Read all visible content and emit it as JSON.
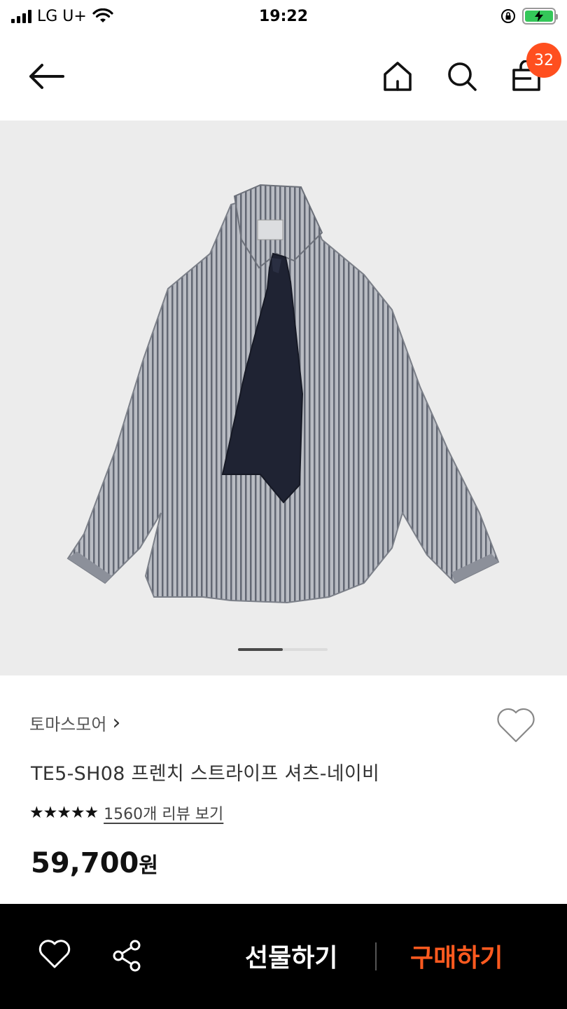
{
  "status_bar": {
    "carrier": "LG U+",
    "time": "19:22"
  },
  "nav": {
    "cart_count": "32",
    "icons": [
      "back-arrow-icon",
      "home-icon",
      "search-icon",
      "shopping-bag-icon"
    ]
  },
  "gallery": {
    "current_image": 1,
    "total_images": 2
  },
  "product": {
    "brand": "토마스모어",
    "brand_chevron": "›",
    "title": "TE5-SH08 프렌치 스트라이프 셔츠-네이비",
    "stars": "★★★★★",
    "rating": 5,
    "review_link": "1560개 리뷰 보기",
    "price": "59,700",
    "price_unit": "원"
  },
  "bottom_bar": {
    "gift_label": "선물하기",
    "buy_label": "구매하기",
    "icons": [
      "heart-outline-icon",
      "share-icon"
    ]
  },
  "colors": {
    "accent": "#ff5a1f",
    "badge": "#ff4f1f",
    "gallery_bg": "#ececec",
    "bottom_bar_bg": "#000000"
  }
}
